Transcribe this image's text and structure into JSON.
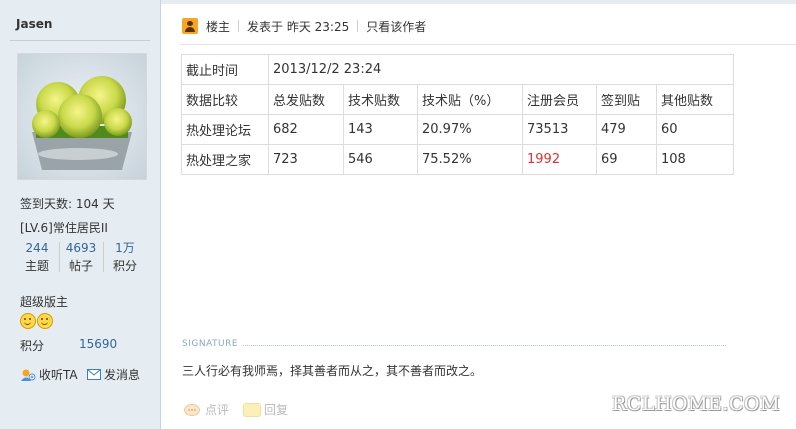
{
  "author": {
    "name": "Jasen",
    "avatar_icon": "cactus-avatar",
    "checkin": "签到天数: 104 天",
    "level": "[LV.6]常住居民II",
    "stats": [
      {
        "value": "244",
        "label": "主题"
      },
      {
        "value": "4693",
        "label": "帖子"
      },
      {
        "value": "1万",
        "label": "积分"
      }
    ],
    "group": "超级版主",
    "points_label": "积分",
    "points_value": "15690",
    "follow_label": "收听TA",
    "message_label": "发消息"
  },
  "post": {
    "op_label": "楼主",
    "posted": "发表于 昨天 23:25",
    "only_author": "只看该作者"
  },
  "table": {
    "cutoff_label": "截止时间",
    "cutoff_value": "2013/12/2  23:24",
    "headers": [
      "数据比较",
      "总发贴数",
      "技术贴数",
      "技术贴（%）",
      "注册会员",
      "签到贴",
      "其他贴数"
    ],
    "rows": [
      [
        "热处理论坛",
        "682",
        "143",
        "20.97%",
        "73513",
        "479",
        "60"
      ],
      [
        "热处理之家",
        "723",
        "546",
        "75.52%",
        "1992",
        "69",
        "108"
      ]
    ],
    "highlight_color": "#e03030"
  },
  "signature": {
    "label": "SIGNATURE",
    "text": "三人行必有我师焉，择其善者而从之，其不善者而改之。"
  },
  "footer": {
    "rate_label": "点评",
    "reply_label": "回复"
  },
  "watermark": "RCLHOME.COM"
}
